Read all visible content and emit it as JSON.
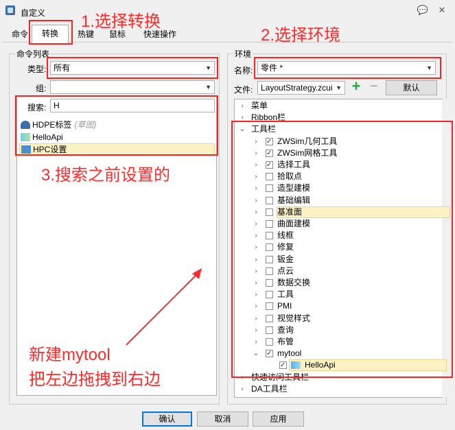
{
  "window": {
    "title": "自定义",
    "help_glyph": "💬",
    "close_glyph": "✕"
  },
  "tabs": [
    "命令",
    "转换",
    "热键",
    "鼠标",
    "快速操作"
  ],
  "annotations": {
    "step1": "1.选择转换",
    "step2": "2.选择环境",
    "step3": "3.搜索之前设置的",
    "note_line1": "新建mytool",
    "note_line2": "把左边拖拽到右边"
  },
  "left": {
    "group_label": "命令列表",
    "type_label": "类型:",
    "type_value": "所有",
    "group_field_label": "组:",
    "group_value": "",
    "search_label": "搜索:",
    "search_value": "H",
    "items": [
      {
        "label": "HDPE标签",
        "hint": "(草图)"
      },
      {
        "label": "HelloApi",
        "hint": ""
      },
      {
        "label": "HPC设置",
        "hint": ""
      }
    ]
  },
  "right": {
    "group_label": "环境",
    "name_label": "名称:",
    "name_value": "零件 *",
    "file_label": "文件:",
    "file_value": "LayoutStrategy.zcui",
    "add_glyph": "+",
    "remove_glyph": "−",
    "default_label": "默认",
    "tree": [
      {
        "label": "菜单",
        "expanded": false
      },
      {
        "label": "Ribbon栏",
        "expanded": false
      },
      {
        "label": "工具栏",
        "expanded": true
      },
      {
        "label": "ZWSim几何工具",
        "checked": true
      },
      {
        "label": "ZWSim网格工具",
        "checked": true
      },
      {
        "label": "选择工具",
        "checked": true
      },
      {
        "label": "拾取点",
        "checked": false
      },
      {
        "label": "造型建模",
        "checked": false
      },
      {
        "label": "基础编辑",
        "checked": false
      },
      {
        "label": "基准面",
        "checked": false
      },
      {
        "label": "曲面建模",
        "checked": false
      },
      {
        "label": "线框",
        "checked": false
      },
      {
        "label": "修复",
        "checked": false
      },
      {
        "label": "钣金",
        "checked": false
      },
      {
        "label": "点云",
        "checked": false
      },
      {
        "label": "数据交换",
        "checked": false
      },
      {
        "label": "工具",
        "checked": false
      },
      {
        "label": "PMI",
        "checked": false
      },
      {
        "label": "视觉样式",
        "checked": false
      },
      {
        "label": "查询",
        "checked": false
      },
      {
        "label": "布管",
        "checked": false
      },
      {
        "label": "mytool",
        "checked": true
      },
      {
        "label": "HelloApi",
        "checked": true
      },
      {
        "label": "快速访问工具栏",
        "expanded": false
      },
      {
        "label": "DA工具栏",
        "expanded": false
      }
    ]
  },
  "buttons": {
    "ok": "确认",
    "cancel": "取消",
    "apply": "应用"
  },
  "colors": {
    "annotation": "#ff2a2a",
    "selection": "#fcf2c6",
    "add_icon": "#2ea043"
  }
}
